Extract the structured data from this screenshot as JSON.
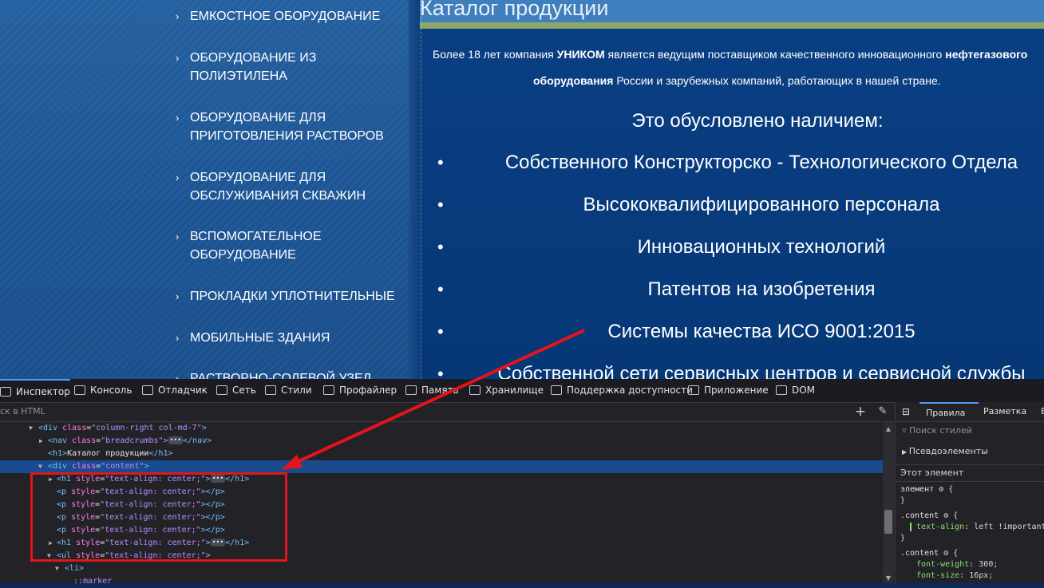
{
  "sidebar": {
    "items": [
      {
        "label": "ЕМКОСТНОЕ ОБОРУДОВАНИЕ",
        "lines": [
          "ЕМКОСТНОЕ ОБОРУДОВАНИЕ"
        ]
      },
      {
        "label": "ОБОРУДОВАНИЕ ИЗ ПОЛИЭТИЛЕНА",
        "lines": [
          "ОБОРУДОВАНИЕ ИЗ",
          "ПОЛИЭТИЛЕНА"
        ]
      },
      {
        "label": "ОБОРУДОВАНИЕ ДЛЯ ПРИГОТОВЛЕНИЯ РАСТВОРОВ",
        "lines": [
          "ОБОРУДОВАНИЕ ДЛЯ",
          "ПРИГОТОВЛЕНИЯ РАСТВОРОВ"
        ]
      },
      {
        "label": "ОБОРУДОВАНИЕ ДЛЯ ОБСЛУЖИВАНИЯ СКВАЖИН",
        "lines": [
          "ОБОРУДОВАНИЕ ДЛЯ",
          "ОБСЛУЖИВАНИЯ СКВАЖИН"
        ]
      },
      {
        "label": "ВСПОМОГАТЕЛЬНОЕ ОБОРУДОВАНИЕ",
        "lines": [
          "ВСПОМОГАТЕЛЬНОЕ",
          "ОБОРУДОВАНИЕ"
        ]
      },
      {
        "label": "ПРОКЛАДКИ УПЛОТНИТЕЛЬНЫЕ",
        "lines": [
          "ПРОКЛАДКИ УПЛОТНИТЕЛЬНЫЕ"
        ]
      },
      {
        "label": "МОБИЛЬНЫЕ ЗДАНИЯ",
        "lines": [
          "МОБИЛЬНЫЕ ЗДАНИЯ"
        ]
      },
      {
        "label": "РАСТВОРНО-СОЛЕВОЙ УЗЕЛ",
        "lines": [
          "РАСТВОРНО-СОЛЕВОЙ УЗЕЛ"
        ]
      }
    ],
    "chevron": "›"
  },
  "content": {
    "title": "Каталог продукции",
    "intro": {
      "line1_a": "Более 18 лет компания ",
      "line1_b": "УНИКОМ",
      "line1_c": " является ведущим поставщиком качественного инновационного ",
      "line1_d": "нефтегазового",
      "line2_a": "оборудования",
      "line2_b": " России и зарубежных компаний, работающих в нашей стране."
    },
    "subheading": "Это обусловлено наличием:",
    "bullets": [
      "Собственного Конструкторско - Технологического Отдела",
      "Высококвалифицированного персонала",
      "Инновационных технологий",
      "Патентов на изобретения",
      "Системы качества ИСО 9001:2015",
      "Собственной сети сервисных центров и сервисной службы"
    ],
    "bullet_symbol": "•"
  },
  "devtools": {
    "tabs": [
      {
        "label": "Инспектор",
        "icon": "inspector-icon",
        "active": true
      },
      {
        "label": "Консоль",
        "icon": "console-icon"
      },
      {
        "label": "Отладчик",
        "icon": "debugger-icon"
      },
      {
        "label": "Сеть",
        "icon": "network-icon"
      },
      {
        "label": "Стили",
        "icon": "braces-icon"
      },
      {
        "label": "Профайлер",
        "icon": "profiler-icon"
      },
      {
        "label": "Память",
        "icon": "memory-icon"
      },
      {
        "label": "Хранилище",
        "icon": "storage-icon"
      },
      {
        "label": "Поддержка доступности",
        "icon": "accessibility-icon"
      },
      {
        "label": "Приложение",
        "icon": "application-icon"
      },
      {
        "label": "DOM",
        "icon": "dom-icon"
      }
    ],
    "search_placeholder": "ск в HTML",
    "add_symbol": "+",
    "picker_symbol": "✎",
    "html_rows": {
      "r0": {
        "tag_open": "<div ",
        "attr": "class",
        "eq": "=",
        "val": "\"column-right col-md-7\"",
        "close": ">"
      },
      "r1": {
        "tag_open": "<nav ",
        "attr": "class",
        "eq": "=",
        "val": "\"breadcrumbs\"",
        "close": ">",
        "ellipsis": "•••",
        "end": "</nav>"
      },
      "r2": {
        "tag_open": "<h1>",
        "text": "Каталог продукции",
        "end": "</h1>"
      },
      "r3": {
        "tag_open": "<div ",
        "attr": "class",
        "eq": "=",
        "val": "\"content\"",
        "close": ">"
      },
      "r4": {
        "tag_open": "<h1 ",
        "attr": "style",
        "eq": "=",
        "val": "\"text-align: center;\"",
        "close": ">",
        "ellipsis": "•••",
        "end": "</h1>"
      },
      "r5": {
        "tag_open": "<p ",
        "attr": "style",
        "eq": "=",
        "val": "\"text-align: center;\"",
        "close": ">",
        "end": "</p>"
      },
      "r6": {
        "tag_open": "<p ",
        "attr": "style",
        "eq": "=",
        "val": "\"text-align: center;\"",
        "close": ">",
        "end": "</p>"
      },
      "r7": {
        "tag_open": "<p ",
        "attr": "style",
        "eq": "=",
        "val": "\"text-align: center;\"",
        "close": ">",
        "end": "</p>"
      },
      "r8": {
        "tag_open": "<p ",
        "attr": "style",
        "eq": "=",
        "val": "\"text-align: center;\"",
        "close": ">",
        "end": "</p>"
      },
      "r9": {
        "tag_open": "<h1 ",
        "attr": "style",
        "eq": "=",
        "val": "\"text-align: center;\"",
        "close": ">",
        "ellipsis": "•••",
        "end": "</h1>"
      },
      "r10": {
        "tag_open": "<ul ",
        "attr": "style",
        "eq": "=",
        "val": "\"text-align: center;\"",
        "close": ">"
      },
      "r11": {
        "tag_open": "<li>"
      },
      "r12": {
        "text": "::marker"
      }
    },
    "rules": {
      "tabs": [
        "Правила",
        "Разметка",
        "В"
      ],
      "filter_placeholder": "Поиск стилей",
      "pseudo": "Псевдоэлементы",
      "this_element": "Этот элемент",
      "element_selector": "элемент",
      "brace_open": "{",
      "brace_close": "}",
      "content_selector": ".content",
      "prop1": "text-align",
      "val1": "left !important;",
      "prop2": "font-weight",
      "val2": "300;",
      "prop3": "font-size",
      "val3": "16px;"
    }
  },
  "colors": {
    "annotation": "#e3141b",
    "selected_row": "#1b4b8f"
  }
}
